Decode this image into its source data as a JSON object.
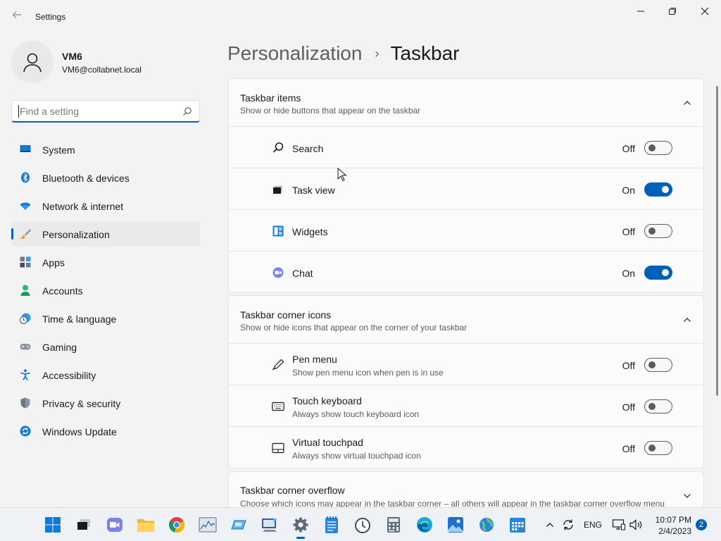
{
  "window": {
    "title": "Settings"
  },
  "profile": {
    "name": "VM6",
    "email": "VM6@collabnet.local"
  },
  "search": {
    "placeholder": "Find a setting"
  },
  "sidebar": {
    "items": [
      {
        "label": "System",
        "icon": "monitor-icon"
      },
      {
        "label": "Bluetooth & devices",
        "icon": "bluetooth-icon"
      },
      {
        "label": "Network & internet",
        "icon": "wifi-icon"
      },
      {
        "label": "Personalization",
        "icon": "brush-icon",
        "active": true
      },
      {
        "label": "Apps",
        "icon": "apps-icon"
      },
      {
        "label": "Accounts",
        "icon": "person-icon"
      },
      {
        "label": "Time & language",
        "icon": "clock-globe-icon"
      },
      {
        "label": "Gaming",
        "icon": "gamepad-icon"
      },
      {
        "label": "Accessibility",
        "icon": "accessibility-icon"
      },
      {
        "label": "Privacy & security",
        "icon": "shield-icon"
      },
      {
        "label": "Windows Update",
        "icon": "update-icon"
      }
    ]
  },
  "breadcrumb": {
    "parent": "Personalization",
    "separator": "›",
    "current": "Taskbar"
  },
  "sections": {
    "taskbar_items": {
      "title": "Taskbar items",
      "subtitle": "Show or hide buttons that appear on the taskbar",
      "rows": [
        {
          "label": "Search",
          "state": "Off",
          "on": false,
          "icon": "search-icon"
        },
        {
          "label": "Task view",
          "state": "On",
          "on": true,
          "icon": "task-view-icon"
        },
        {
          "label": "Widgets",
          "state": "Off",
          "on": false,
          "icon": "widgets-icon"
        },
        {
          "label": "Chat",
          "state": "On",
          "on": true,
          "icon": "chat-icon"
        }
      ]
    },
    "corner_icons": {
      "title": "Taskbar corner icons",
      "subtitle": "Show or hide icons that appear on the corner of your taskbar",
      "rows": [
        {
          "label": "Pen menu",
          "sub": "Show pen menu icon when pen is in use",
          "state": "Off",
          "on": false,
          "icon": "pen-icon"
        },
        {
          "label": "Touch keyboard",
          "sub": "Always show touch keyboard icon",
          "state": "Off",
          "on": false,
          "icon": "keyboard-icon"
        },
        {
          "label": "Virtual touchpad",
          "sub": "Always show virtual touchpad icon",
          "state": "Off",
          "on": false,
          "icon": "touchpad-icon"
        }
      ]
    },
    "corner_overflow": {
      "title": "Taskbar corner overflow",
      "subtitle": "Choose which icons may appear in the taskbar corner – all others will appear in the taskbar corner overflow menu"
    }
  },
  "taskbar": {
    "language": "ENG",
    "time": "10:07 PM",
    "date": "2/4/2023",
    "notifications": "2"
  },
  "colors": {
    "accent": "#005fb8",
    "background": "#f3f3f3",
    "card": "#fbfbfb"
  }
}
